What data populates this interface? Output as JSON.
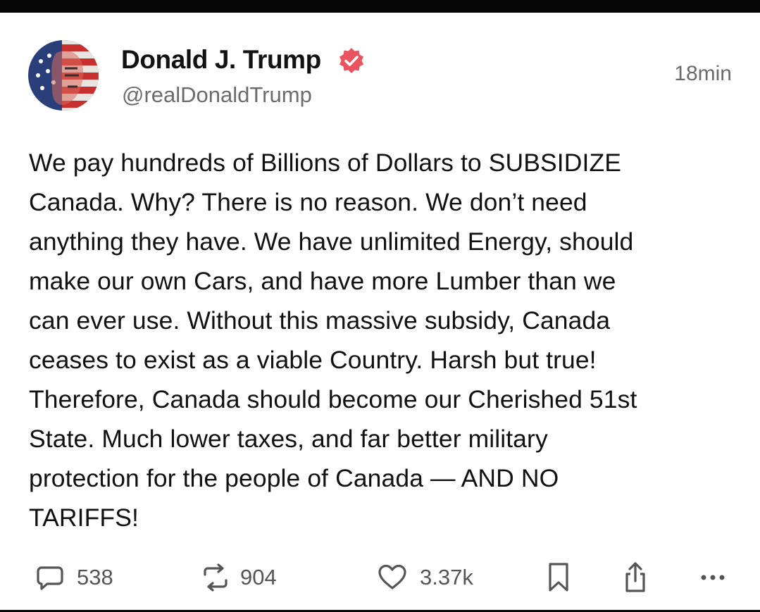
{
  "post": {
    "author": {
      "display_name": "Donald J. Trump",
      "handle": "@realDonaldTrump",
      "verified": true,
      "verified_color": "#e8545f"
    },
    "timestamp": "18min",
    "text": "We pay hundreds of Billions of Dollars to SUBSIDIZE\nCanada. Why? There is no reason. We don’t need\nanything they have. We have unlimited Energy, should\nmake our own Cars, and have more Lumber than we\ncan ever use. Without this massive subsidy, Canada\nceases to exist as a viable Country. Harsh but true!\nTherefore, Canada should become our Cherished 51st\nState. Much lower taxes, and far better military\nprotection for the people of Canada — AND NO\nTARIFFS!",
    "actions": {
      "replies": {
        "icon": "reply-icon",
        "count": "538"
      },
      "reposts": {
        "icon": "repost-icon",
        "count": "904"
      },
      "likes": {
        "icon": "heart-icon",
        "count": "3.37k"
      },
      "bookmark": {
        "icon": "bookmark-icon"
      },
      "share": {
        "icon": "share-icon"
      },
      "more": {
        "icon": "more-icon"
      }
    }
  },
  "colors": {
    "text": "#111111",
    "muted": "#6b6b6b",
    "icon": "#555555",
    "frame": "#050505"
  }
}
